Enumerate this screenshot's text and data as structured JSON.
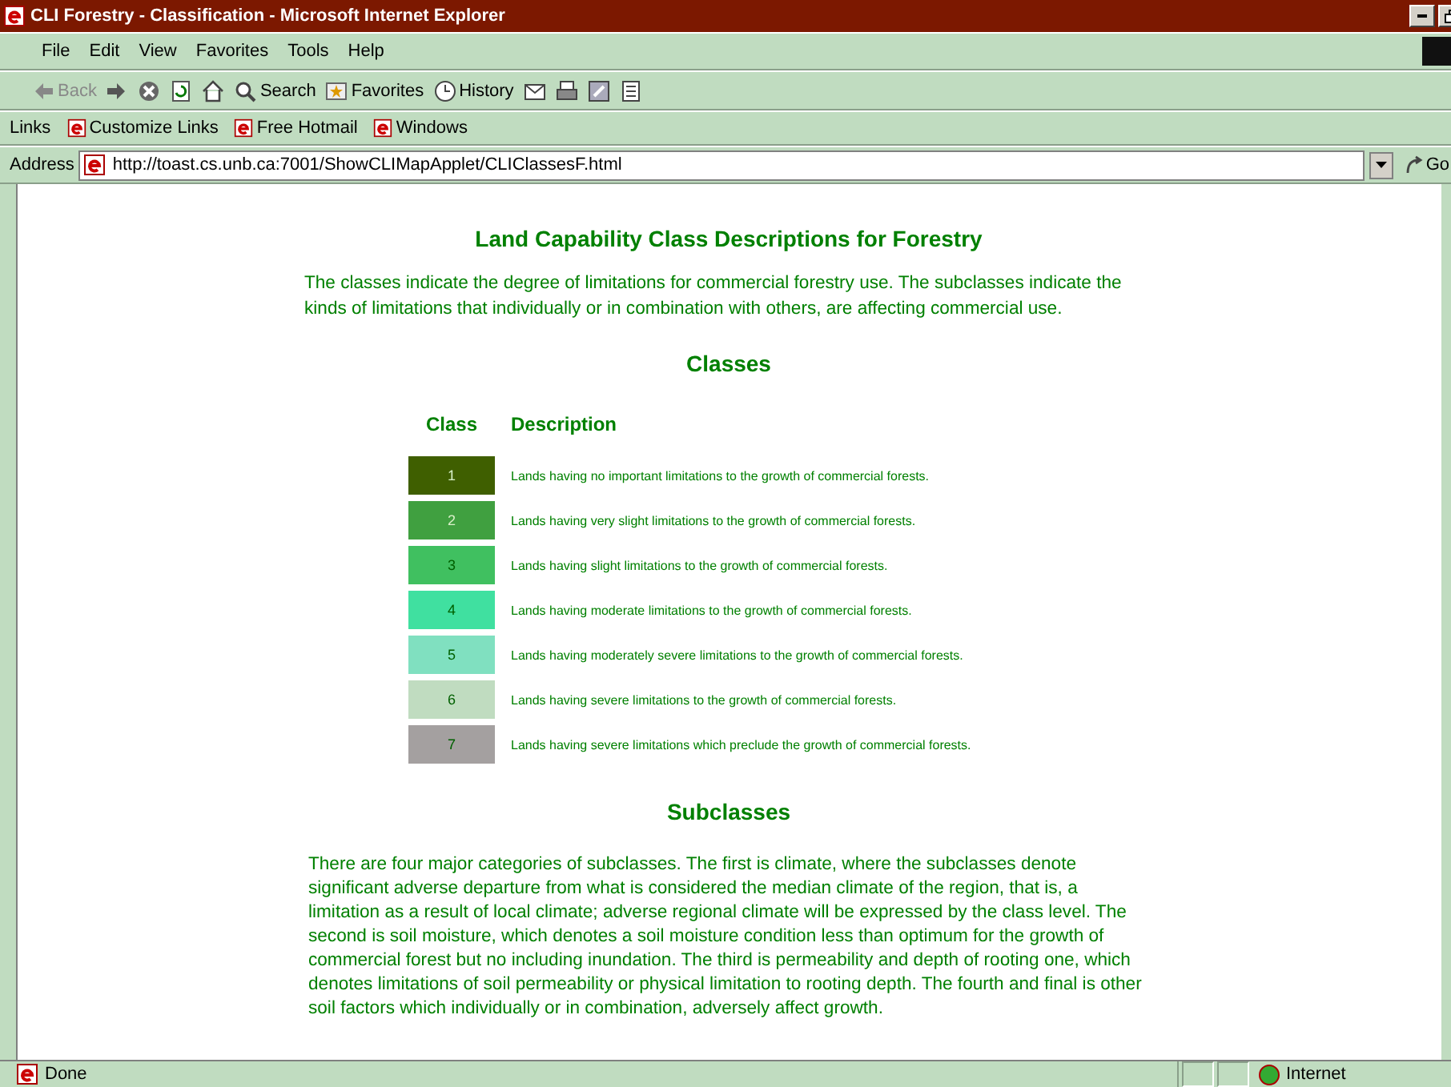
{
  "window": {
    "title": "CLI Forestry - Classification - Microsoft Internet Explorer"
  },
  "menu": [
    "File",
    "Edit",
    "View",
    "Favorites",
    "Tools",
    "Help"
  ],
  "toolbar": [
    {
      "kind": "back",
      "label": "Back"
    },
    {
      "kind": "forward"
    },
    {
      "kind": "stop"
    },
    {
      "kind": "refresh"
    },
    {
      "kind": "home"
    },
    {
      "kind": "search",
      "label": "Search"
    },
    {
      "kind": "favorites",
      "label": "Favorites"
    },
    {
      "kind": "history",
      "label": "History"
    },
    {
      "kind": "mail"
    },
    {
      "kind": "print"
    },
    {
      "kind": "edit"
    },
    {
      "kind": "discuss"
    }
  ],
  "links": {
    "label": "Links",
    "items": [
      "Customize Links",
      "Free Hotmail",
      "Windows"
    ]
  },
  "address": {
    "label": "Address",
    "value": "http://toast.cs.unb.ca:7001/ShowCLIMapApplet/CLIClassesF.html",
    "go": "Go"
  },
  "page": {
    "title": "Land Capability Class Descriptions for Forestry",
    "intro": "The classes indicate the degree of limitations for commercial forestry use. The subclasses indicate the kinds of limitations that individually or in combination with others, are affecting commercial use.",
    "classes_heading": "Classes",
    "columns": [
      "Class",
      "Description"
    ],
    "classes": [
      {
        "class": "1",
        "color": "#3f5f00",
        "description": "Lands having no important limitations to the growth of commercial forests."
      },
      {
        "class": "2",
        "color": "#40a040",
        "description": "Lands having very slight limitations to the growth of commercial forests."
      },
      {
        "class": "3",
        "color": "#40c060",
        "description": "Lands having slight limitations to the growth of commercial forests."
      },
      {
        "class": "4",
        "color": "#40e0a0",
        "description": "Lands having moderate limitations to the growth of commercial forests."
      },
      {
        "class": "5",
        "color": "#80e0c0",
        "description": "Lands having moderately severe limitations to the growth of commercial forests."
      },
      {
        "class": "6",
        "color": "#c0dcc0",
        "description": "Lands having severe limitations to the growth of commercial forests."
      },
      {
        "class": "7",
        "color": "#a4a0a0",
        "description": "Lands having severe limitations which preclude the growth of commercial forests."
      }
    ],
    "subclasses_heading": "Subclasses",
    "subclasses_text": "There are four major categories of subclasses. The first is climate, where the subclasses denote significant adverse departure from what is considered the median climate of the region, that is, a limitation as a result of local climate; adverse regional climate will be expressed by the class level. The second is soil moisture, which denotes a soil moisture condition less than optimum for the growth of commercial forest but no including inundation. The third is permeability and depth of rooting one, which denotes limitations of soil permeability or physical limitation to rooting depth. The fourth and final is other soil factors which individually or in combination, adversely affect growth."
  },
  "status_bar": {
    "text": "Done",
    "zone": "Internet"
  }
}
